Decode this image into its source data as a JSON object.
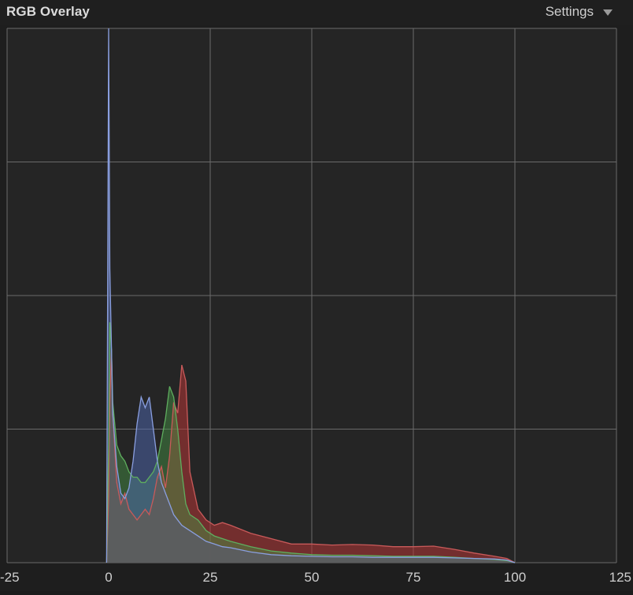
{
  "header": {
    "title": "RGB Overlay",
    "settings_label": "Settings",
    "settings_icon": "chevron-down-icon"
  },
  "colors": {
    "background": "#1e1e1e",
    "plot_background": "#252525",
    "grid": "#6a6a6a",
    "red": "#b33a3a",
    "green": "#3e8a3e",
    "blue": "#4a5fa8",
    "overlap_gray": "#5a5a5a"
  },
  "chart_data": {
    "type": "area",
    "title": "",
    "xlabel": "",
    "ylabel": "",
    "xlim": [
      -25,
      125
    ],
    "ylim": [
      0,
      1
    ],
    "x_ticks": [
      -25,
      0,
      25,
      50,
      75,
      100,
      125
    ],
    "x_tick_labels": [
      "-25",
      "0",
      "25",
      "50",
      "75",
      "100",
      "125"
    ],
    "y_gridlines": 4,
    "grid": true,
    "x": [
      -0.5,
      0,
      0.3,
      0.7,
      1,
      2,
      3,
      4,
      5,
      6,
      7,
      8,
      9,
      10,
      11,
      12,
      13,
      14,
      15,
      16,
      17,
      18,
      19,
      20,
      22,
      24,
      26,
      28,
      30,
      35,
      40,
      45,
      50,
      55,
      60,
      65,
      70,
      75,
      80,
      85,
      90,
      95,
      98,
      100
    ],
    "series": [
      {
        "color": "red",
        "values": [
          0,
          0.12,
          0.3,
          0.4,
          0.28,
          0.15,
          0.11,
          0.13,
          0.1,
          0.09,
          0.08,
          0.09,
          0.1,
          0.09,
          0.12,
          0.16,
          0.18,
          0.14,
          0.2,
          0.3,
          0.28,
          0.37,
          0.34,
          0.17,
          0.1,
          0.08,
          0.07,
          0.075,
          0.07,
          0.055,
          0.045,
          0.035,
          0.035,
          0.033,
          0.034,
          0.033,
          0.03,
          0.03,
          0.031,
          0.025,
          0.018,
          0.012,
          0.008,
          0
        ]
      },
      {
        "color": "green",
        "values": [
          0,
          0.22,
          0.45,
          0.4,
          0.3,
          0.22,
          0.2,
          0.19,
          0.17,
          0.16,
          0.16,
          0.15,
          0.15,
          0.16,
          0.17,
          0.19,
          0.23,
          0.27,
          0.33,
          0.31,
          0.25,
          0.17,
          0.11,
          0.09,
          0.08,
          0.06,
          0.05,
          0.045,
          0.04,
          0.03,
          0.022,
          0.018,
          0.015,
          0.014,
          0.014,
          0.013,
          0.012,
          0.012,
          0.012,
          0.01,
          0.008,
          0.006,
          0.004,
          0
        ]
      },
      {
        "color": "blue",
        "values": [
          0,
          1.0,
          0.55,
          0.4,
          0.28,
          0.18,
          0.13,
          0.12,
          0.14,
          0.19,
          0.26,
          0.31,
          0.29,
          0.31,
          0.25,
          0.19,
          0.15,
          0.13,
          0.11,
          0.09,
          0.08,
          0.07,
          0.065,
          0.06,
          0.05,
          0.04,
          0.035,
          0.03,
          0.028,
          0.02,
          0.015,
          0.013,
          0.012,
          0.011,
          0.011,
          0.01,
          0.01,
          0.01,
          0.01,
          0.009,
          0.008,
          0.007,
          0.005,
          0
        ]
      }
    ]
  }
}
